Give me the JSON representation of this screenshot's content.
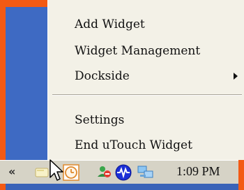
{
  "menu": {
    "items": [
      {
        "label": "Add Widget"
      },
      {
        "label": "Widget Management"
      },
      {
        "label": "Dockside",
        "has_submenu": true
      },
      {
        "label": "Settings"
      },
      {
        "label": "End uTouch Widget"
      }
    ]
  },
  "taskbar": {
    "overflow_chevron": "«",
    "tray_icons": [
      "notification-icon",
      "clock-app-icon",
      "users-icon",
      "network-activity-icon",
      "connection-icon"
    ],
    "clock": "1:09 PM"
  },
  "colors": {
    "frame": "#f35a14",
    "desktop": "#3a63b8",
    "menu_bg": "#f3f1e7",
    "taskbar_bg": "#d6d3c6"
  }
}
